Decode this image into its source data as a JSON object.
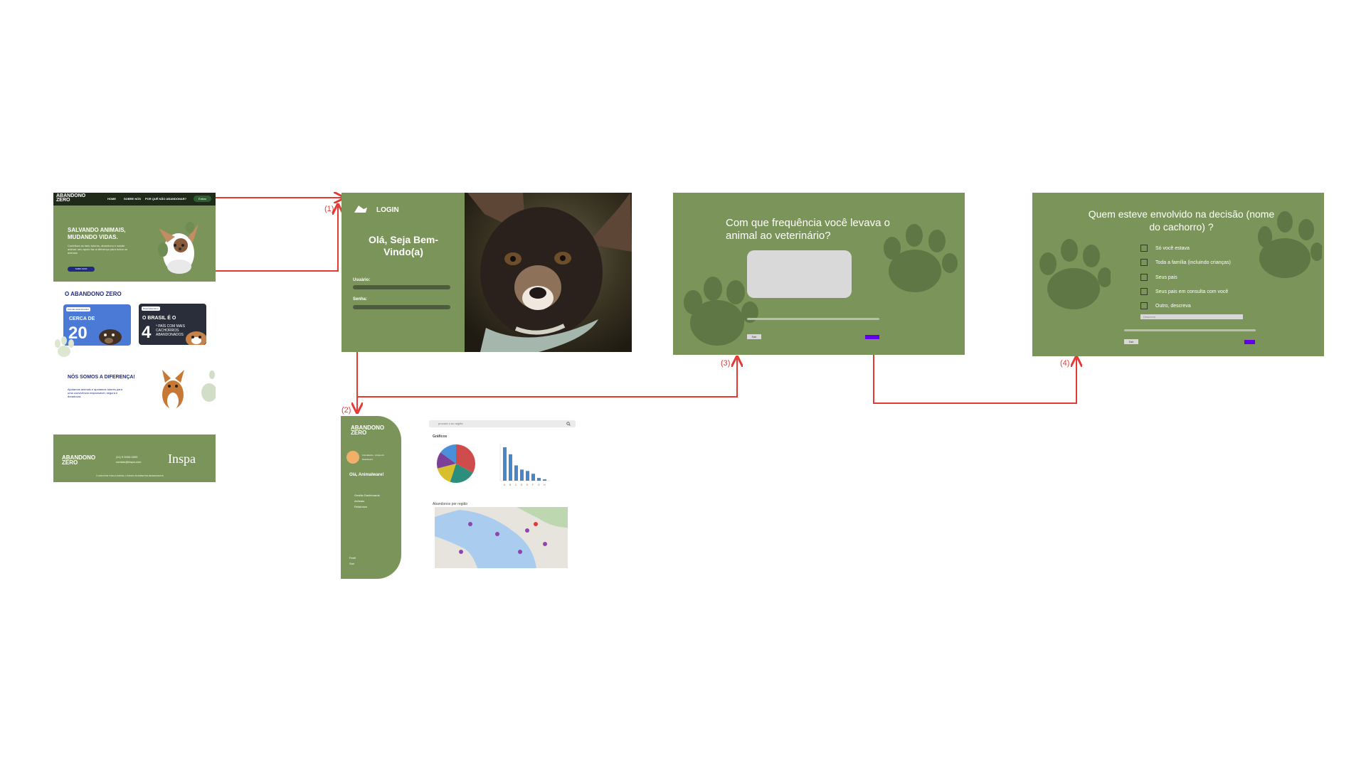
{
  "landing": {
    "brand": "ABANDONO ZERO",
    "nav": [
      "HOME",
      "SOBRE NÓS",
      "POR QUÊ NÃO ABANDONAR?",
      "Entrar"
    ],
    "hero_title": "SALVANDO ANIMAIS, MUDANDO VIDAS.",
    "hero_text": "Contribua ao lado tutores, abandono e saúde animal: seu apoio faz a diferença para todos os animais",
    "hero_button": "SAIBA MAIS",
    "about_title": "O ABANDONO ZERO",
    "stat_left_pill": "Animais abandonados",
    "stat_left_small": "CERCA DE",
    "stat_left_number": "20",
    "stat_right_pill": "Brasil abandono",
    "stat_right_small": "O BRASIL É O",
    "stat_right_number": "4",
    "stat_right_text": "º PAÍS COM MAIS CACHORROS ABANDONADOS",
    "difference_title": "NÓS SOMOS A DIFERENÇA!",
    "difference_text": "Ajudamos animais e apoiamos tutores para uma convivência responsável, segura e duradoura.",
    "footer_brand": "ABANDONO ZERO",
    "footer_contact": [
      "(11) 9 0000-0000",
      "contato@inspa.com"
    ],
    "footer_partner": "Inspa",
    "footer_copy": "© 2023 POR TODA A ANIMAL | TODOS OS DIREITOS RESERVADOS"
  },
  "login": {
    "title": "LOGIN",
    "greeting": "Olá, Seja Bem-Vindo(a)",
    "user_label": "Usuário:",
    "password_label": "Senha:"
  },
  "survey_frequency": {
    "question": "Com que frequência você levava o animal ao veterinário?",
    "back_label": "Sair"
  },
  "survey_decision": {
    "question": "Quem esteve envolvido na decisão (nome do cachorro) ?",
    "options": [
      "Só você estava",
      "Toda a família (incluindo crianças)",
      "Seus pais",
      "Seus pais em consulta com você",
      "Outro, descreva"
    ],
    "input_placeholder": "Descreva",
    "back_label": "Sair"
  },
  "dashboard": {
    "brand": "ABANDONO ZERO",
    "user_name": "Animalware - Amigo do",
    "user_sub": "Dashboard",
    "greeting": "Olá, Animalware!",
    "menu": [
      "Gestão Dashboards",
      "Animais",
      "Relatórios"
    ],
    "footer": [
      "Perfil",
      "Sair"
    ],
    "search_placeholder": "procure o eu região",
    "charts_title": "Gráficos",
    "map_title": "Abandonos por região"
  },
  "steps": [
    "(1)",
    "(2)",
    "(3)",
    "(4)"
  ],
  "colors": {
    "green": "#7a9459",
    "dark_green": "#1f2a18",
    "flow": "#e53935",
    "purple": "#6200ea",
    "navy": "#1f2b84"
  },
  "chart_data": {
    "type": "bar",
    "categories": [
      "A",
      "B",
      "C",
      "D",
      "E",
      "F",
      "G",
      "H"
    ],
    "values": [
      24,
      19,
      11,
      8,
      7,
      5,
      2,
      1
    ],
    "pie_values": [
      33,
      22,
      16,
      14,
      15
    ]
  }
}
